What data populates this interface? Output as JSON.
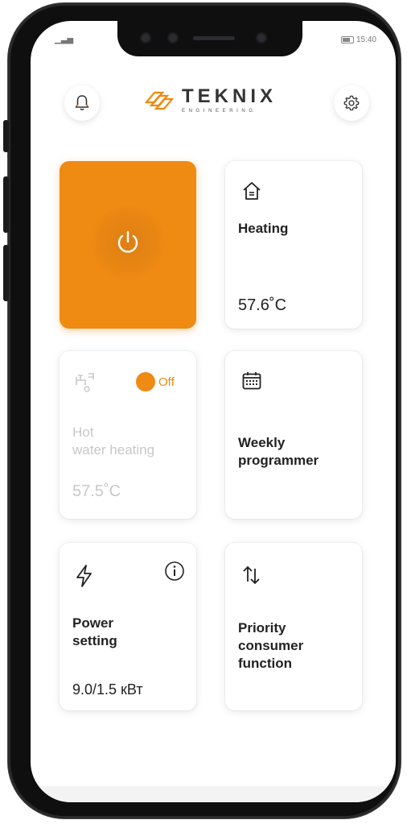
{
  "status_bar": {
    "signal": "▁▃▅",
    "time": "15:40"
  },
  "header": {
    "logo_text": "TEKNIX",
    "logo_sub": "ENGINEERING",
    "bell_icon": "bell-icon",
    "settings_icon": "gear-icon"
  },
  "colors": {
    "accent": "#ef8a13",
    "disabled": "#c8c8c8",
    "text": "#222222"
  },
  "tiles": {
    "power": {
      "icon": "power-icon"
    },
    "heating": {
      "title": "Heating",
      "value": "57.6˚C",
      "icon": "house-icon"
    },
    "hot_water": {
      "title_line1": "Hot",
      "title_line2": "water heating",
      "value": "57.5˚C",
      "toggle_label": "Off",
      "icon": "faucet-icon"
    },
    "weekly": {
      "title_line1": "Weekly",
      "title_line2": "programmer",
      "icon": "calendar-icon"
    },
    "power_setting": {
      "title_line1": "Power",
      "title_line2": "setting",
      "value": "9.0/1.5 кВт",
      "icon": "lightning-icon",
      "info_icon": "info-icon"
    },
    "priority": {
      "title_line1": "Priority",
      "title_line2": "consumer",
      "title_line3": "function",
      "icon": "swap-arrows-icon"
    }
  }
}
